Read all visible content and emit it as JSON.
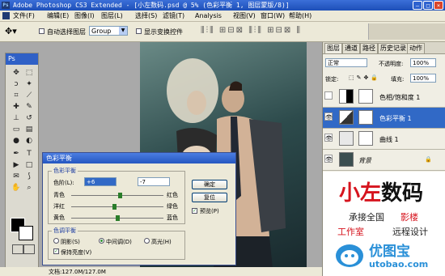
{
  "window": {
    "title": "Adobe Photoshop CS3 Extended - [小左数码.psd @ 5% (色彩平衡 1, 图层蒙版/8)]",
    "ps_label": "Ps"
  },
  "menu": [
    "文件(F)",
    "编辑(E)",
    "图像(I)",
    "图层(L)",
    "选择(S)",
    "滤镜(T)",
    "Analysis",
    "视图(V)",
    "窗口(W)",
    "帮助(H)"
  ],
  "options": {
    "auto_select_label": "自动选择图层",
    "auto_select_value": "Group",
    "show_transform_label": "显示变换控件"
  },
  "status": {
    "doc_size": "文档:127.0M/127.0M"
  },
  "layers_panel": {
    "tabs": [
      "图层",
      "通道",
      "路径",
      "历史记录",
      "动作"
    ],
    "blend_mode": "正常",
    "opacity_label": "不透明度:",
    "opacity_value": "100%",
    "lock_label": "锁定:",
    "fill_label": "填充:",
    "fill_value": "100%",
    "layers": [
      {
        "name": "色相/饱和度 1",
        "selected": false
      },
      {
        "name": "色彩平衡 1",
        "selected": true
      },
      {
        "name": "曲线 1",
        "selected": false
      },
      {
        "name": "背景",
        "selected": false
      }
    ]
  },
  "dialog": {
    "title": "色彩平衡",
    "group1_label": "色彩平衡",
    "levels_label": "色阶(L):",
    "level_values": [
      "+6",
      "-7"
    ],
    "sliders": [
      {
        "left": "青色",
        "right": "红色",
        "value": 6
      },
      {
        "left": "洋红",
        "right": "绿色",
        "value": -7
      },
      {
        "left": "黄色",
        "right": "蓝色",
        "value": 0
      }
    ],
    "ok": "确定",
    "reset": "复位",
    "preview_label": "预览(P)",
    "group2_label": "色调平衡",
    "tones": [
      "阴影(S)",
      "中间调(D)",
      "高光(H)"
    ],
    "selected_tone": "中间调(D)",
    "preserve_label": "保持亮度(V)"
  },
  "watermark": {
    "brand_a": "小左",
    "brand_b": "数码",
    "line1a": "承接全国",
    "line1b": "影楼",
    "line2": "工作室",
    "line3": "远程设计",
    "site_name": "优图宝",
    "site_url": "utobao.com"
  },
  "colors": {
    "accent": "#3169c6",
    "brand_red": "#d6141e",
    "brand_black": "#111111"
  }
}
